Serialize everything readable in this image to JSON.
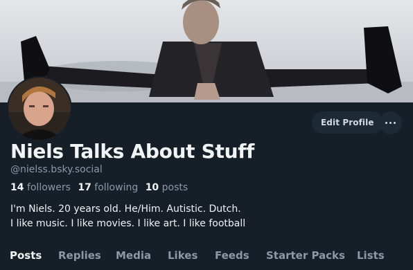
{
  "profile": {
    "display_name": "Niels Talks About Stuff",
    "handle": "@nielss.bsky.social",
    "followers_count": "14",
    "followers_label": "followers",
    "following_count": "17",
    "following_label": "following",
    "posts_count": "10",
    "posts_label": "posts",
    "bio_line1": "I'm Niels. 20 years old. He/Him. Autistic. Dutch.",
    "bio_line2": "I like music. I like movies. I like art. I like football"
  },
  "actions": {
    "edit_profile_label": "Edit Profile",
    "more_icon": "ellipsis-icon"
  },
  "tabs": [
    {
      "label": "Posts",
      "active": true
    },
    {
      "label": "Replies"
    },
    {
      "label": "Media"
    },
    {
      "label": "Likes"
    },
    {
      "label": "Feeds"
    },
    {
      "label": "Starter Packs"
    },
    {
      "label": "Lists"
    }
  ],
  "colors": {
    "background": "#161e27",
    "button_bg": "#1e2936",
    "muted_text": "#8b98a8",
    "primary_text": "#f1f3f5"
  }
}
